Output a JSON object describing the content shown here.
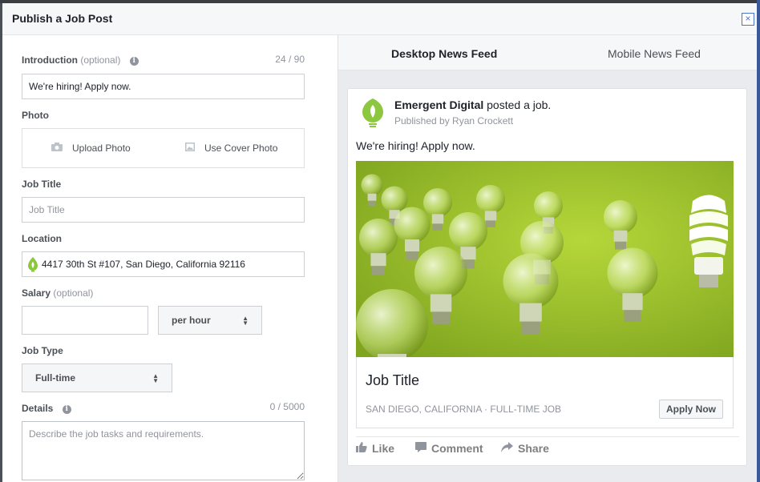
{
  "dialog": {
    "title": "Publish a Job Post",
    "close_glyph": "×"
  },
  "form": {
    "intro": {
      "label": "Introduction",
      "optional": "(optional)",
      "counter": "24 / 90",
      "value": "We're hiring! Apply now."
    },
    "photo": {
      "label": "Photo",
      "upload": "Upload Photo",
      "cover": "Use Cover Photo"
    },
    "job_title": {
      "label": "Job Title",
      "placeholder": "Job Title"
    },
    "location": {
      "label": "Location",
      "value": "4417 30th St #107, San Diego, California 92116"
    },
    "salary": {
      "label": "Salary",
      "optional": "(optional)",
      "value": "",
      "period": "per hour"
    },
    "job_type": {
      "label": "Job Type",
      "value": "Full-time"
    },
    "details": {
      "label": "Details",
      "counter": "0 / 5000",
      "placeholder": "Describe the job tasks and requirements."
    }
  },
  "preview": {
    "tabs": [
      "Desktop News Feed",
      "Mobile News Feed"
    ],
    "page_name": "Emergent Digital",
    "posted_text": "posted a job.",
    "published_by": "Published by Ryan Crockett",
    "post_text": "We're hiring! Apply now.",
    "job_title": "Job Title",
    "job_meta": "SAN DIEGO, CALIFORNIA · FULL-TIME JOB",
    "apply_button": "Apply Now",
    "actions": {
      "like": "Like",
      "comment": "Comment",
      "share": "Share"
    }
  },
  "colors": {
    "brand_green": "#8dc63f",
    "hero_green": "#9ac22d"
  },
  "icons": {
    "info": "info-icon",
    "camera": "camera-icon",
    "image": "image-icon",
    "location": "lightbulb-pin-icon",
    "like": "thumbs-up-icon",
    "comment": "comment-icon",
    "share": "share-icon"
  }
}
